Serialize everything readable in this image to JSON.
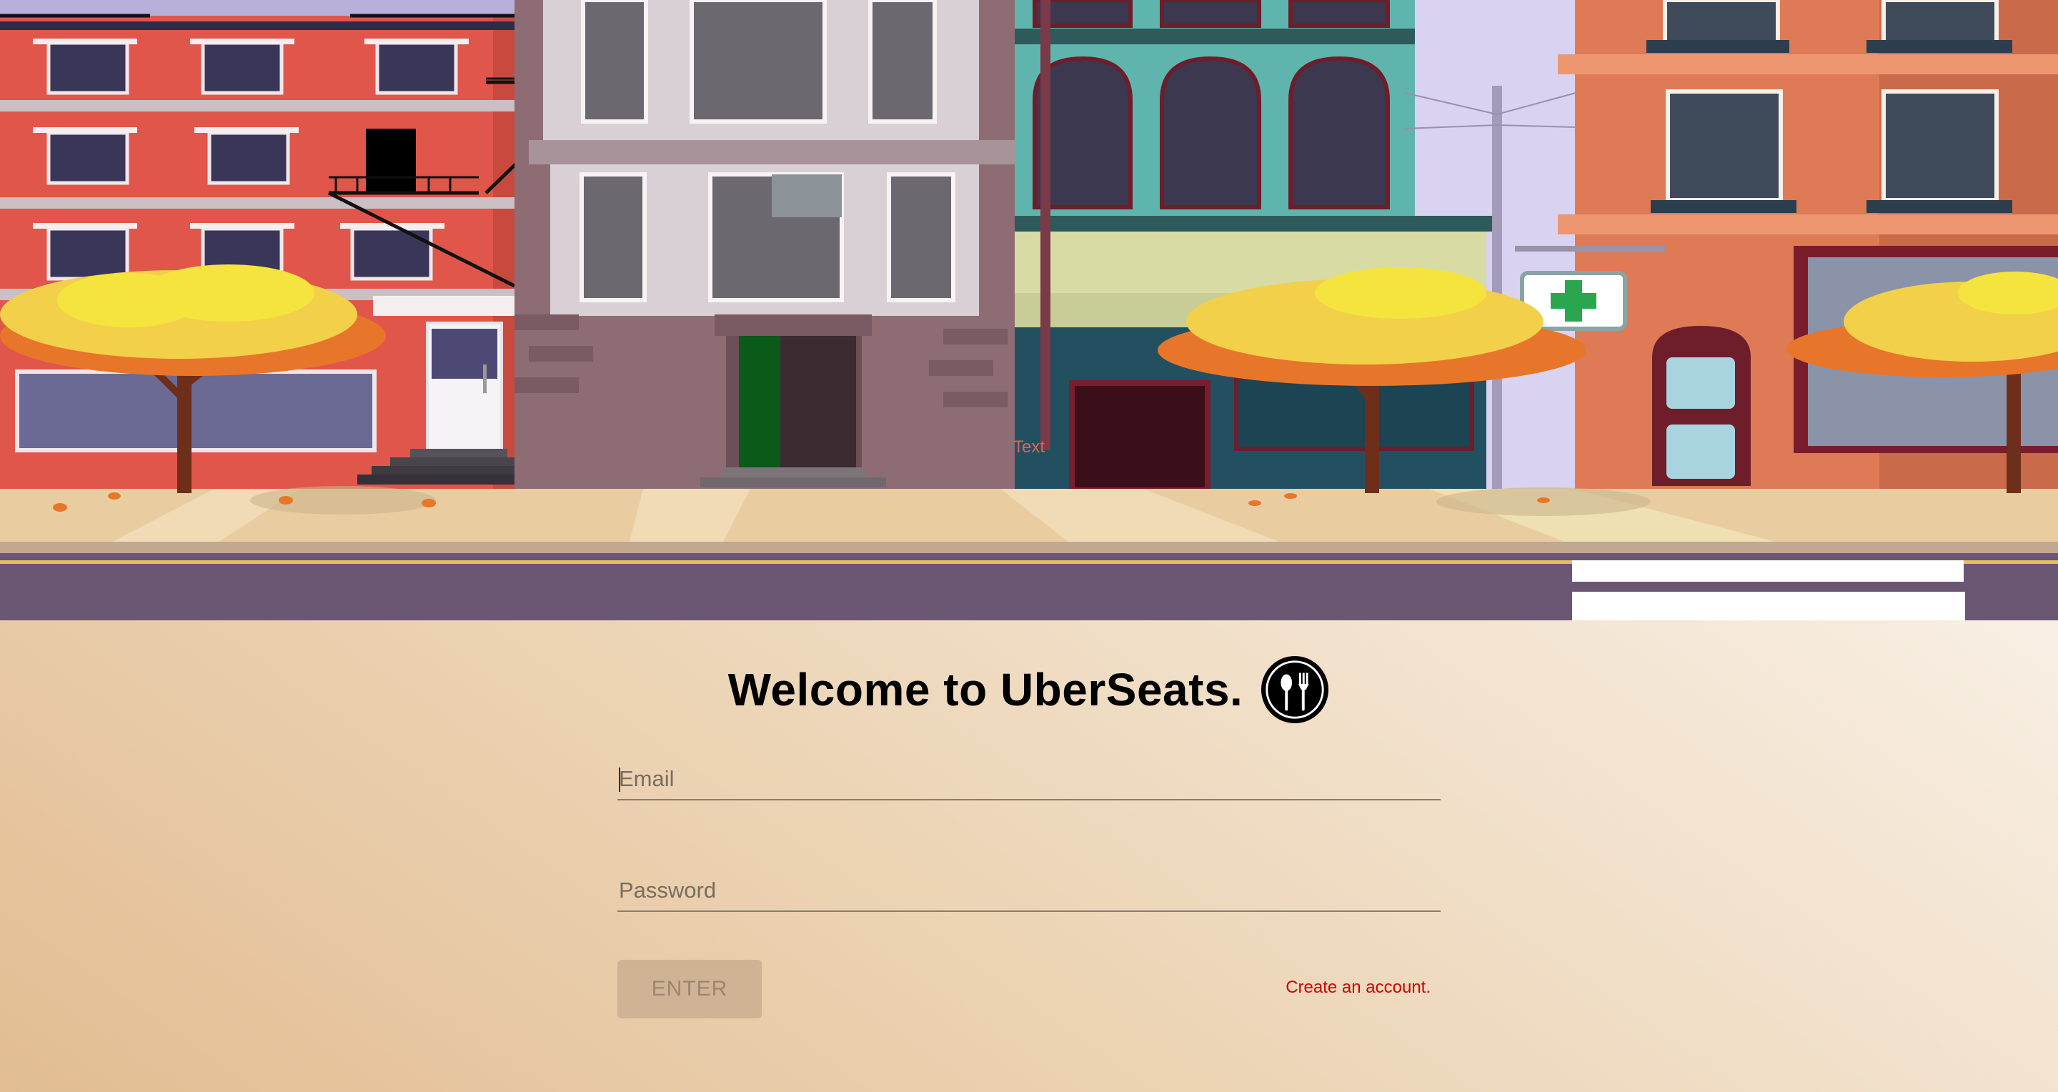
{
  "login": {
    "title": "Welcome to UberSeats.",
    "logo_icon": "spoon-fork-plate-icon",
    "email_placeholder": "Email",
    "password_placeholder": "Password",
    "enter_label": "ENTER",
    "create_account_label": "Create an account."
  },
  "scene": {
    "stray_text": "Text",
    "shop_sign_icon": "pharmacy-cross-icon"
  },
  "colors": {
    "red_building": "#e0564a",
    "teal_building": "#5fb5ad",
    "orange_building": "#df7a56",
    "foliage": "#f2d04a",
    "road": "#6b5674",
    "sidewalk": "#e9cda0",
    "link": "#d00000",
    "button_bg": "#cfb394"
  }
}
